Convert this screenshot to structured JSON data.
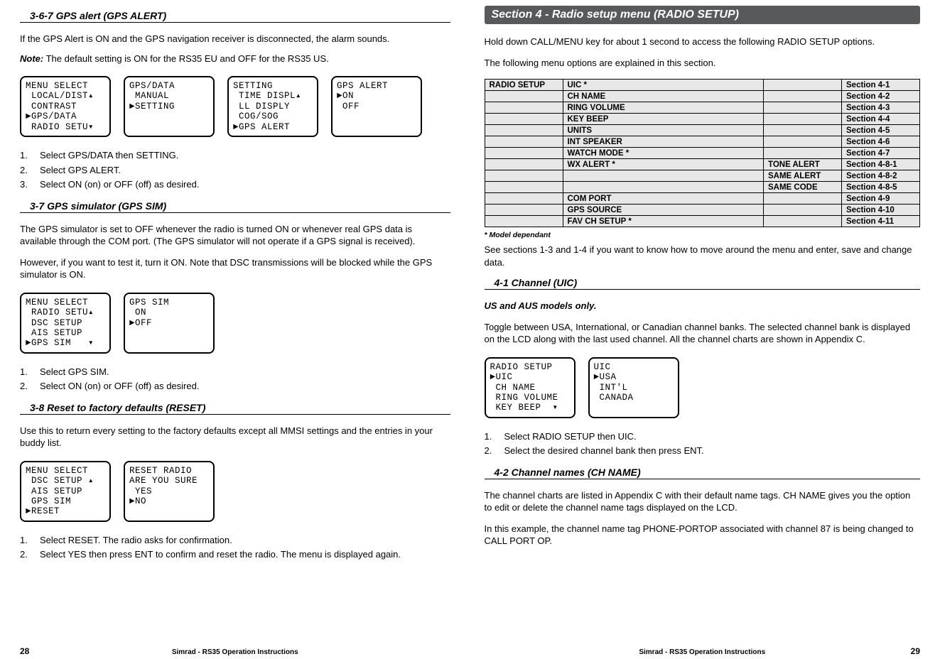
{
  "left": {
    "h1": "3-6-7 GPS alert (GPS ALERT)",
    "p1": "If the GPS Alert is ON and the GPS navigation receiver is disconnected, the alarm sounds.",
    "note_label": "Note:",
    "note_body": " The default setting is ON for the RS35 EU and OFF for the RS35 US.",
    "lcds1": [
      "MENU SELECT\n LOCAL/DIST▴\n CONTRAST\n►GPS/DATA\n RADIO SETU▾",
      "GPS/DATA\n MANUAL\n►SETTING",
      "SETTING\n TIME DISPL▴\n LL DISPLY\n COG/SOG\n►GPS ALERT",
      "GPS ALERT\n►ON\n OFF"
    ],
    "steps1": [
      "Select GPS/DATA then SETTING.",
      "Select GPS ALERT.",
      "Select ON (on) or OFF (off) as desired."
    ],
    "h2": "3-7 GPS simulator (GPS SIM)",
    "p2a": "The GPS simulator is set to OFF whenever the radio is turned ON or whenever real GPS data is available through the COM port. (The GPS simulator will not operate if a GPS signal is received).",
    "p2b": "However, if you want to test it, turn it ON. Note that DSC transmissions will be blocked while the GPS simulator is ON.",
    "lcds2": [
      "MENU SELECT\n RADIO SETU▴\n DSC SETUP\n AIS SETUP\n►GPS SIM   ▾",
      "GPS SIM\n ON\n►OFF"
    ],
    "steps2": [
      "Select GPS SIM.",
      "Select ON (on) or OFF (off) as desired."
    ],
    "h3": "3-8 Reset to factory defaults (RESET)",
    "p3": "Use this to return every setting to the factory defaults except all MMSI settings and the entries in your buddy list.",
    "lcds3": [
      "MENU SELECT\n DSC SETUP ▴\n AIS SETUP\n GPS SIM\n►RESET",
      "RESET RADIO\nARE YOU SURE\n YES\n►NO"
    ],
    "steps3": [
      "Select RESET.  The radio asks for confirmation.",
      "Select YES then press ENT to confirm and reset the radio. The menu is displayed again."
    ],
    "page_num": "28",
    "footer_center": "Simrad - RS35 Operation Instructions"
  },
  "right": {
    "section_title": "Section 4 -  Radio setup menu (RADIO SETUP)",
    "p1a": "Hold down CALL/MENU key for about 1 second to access the following RADIO SETUP options.",
    "p1b": "The following menu options are explained in this section.",
    "table": {
      "rows": [
        [
          "RADIO SETUP",
          "UIC   *",
          "",
          "Section 4-1"
        ],
        [
          "",
          "CH NAME",
          "",
          "Section 4-2"
        ],
        [
          "",
          "RING VOLUME",
          "",
          "Section 4-3"
        ],
        [
          "",
          "KEY BEEP",
          "",
          "Section 4-4"
        ],
        [
          "",
          "UNITS",
          "",
          "Section 4-5"
        ],
        [
          "",
          "INT SPEAKER",
          "",
          "Section 4-6"
        ],
        [
          "",
          "WATCH MODE   *",
          "",
          "Section 4-7"
        ],
        [
          "",
          "WX ALERT   *",
          "TONE ALERT",
          "Section 4-8-1"
        ],
        [
          "",
          "",
          "SAME ALERT",
          "Section 4-8-2"
        ],
        [
          "",
          "",
          "SAME CODE",
          "Section 4-8-5"
        ],
        [
          "",
          "COM PORT",
          "",
          "Section 4-9"
        ],
        [
          "",
          "GPS SOURCE",
          "",
          "Section 4-10"
        ],
        [
          "",
          "FAV CH SETUP  *",
          "",
          "Section 4-11"
        ]
      ]
    },
    "small_note": "* Model dependant",
    "p2": "See sections 1-3 and 1-4 if you want to know how to move around the menu and enter, save and change data.",
    "h1": "4-1 Channel (UIC)",
    "p3_italic": "US and AUS models only.",
    "p4": "Toggle between USA, International, or Canadian channel banks. The selected channel bank is displayed on the LCD along with the last used channel. All the channel charts are shown in Appendix C.",
    "lcds1": [
      "RADIO SETUP\n►UIC\n CH NAME\n RING VOLUME\n KEY BEEP  ▾",
      "UIC\n►USA\n INT'L\n CANADA"
    ],
    "steps1": [
      "Select RADIO SETUP then UIC.",
      "Select the desired channel bank then press ENT."
    ],
    "h2": "4-2 Channel names (CH NAME)",
    "p5": "The channel charts are listed in Appendix C with their default name tags. CH NAME gives you the option to edit or delete the channel name tags displayed on the LCD.",
    "p6": "In this example, the channel name tag PHONE-PORTOP associated with channel 87 is being changed to CALL PORT OP.",
    "page_num": "29",
    "footer_center": "Simrad - RS35 Operation Instructions"
  }
}
